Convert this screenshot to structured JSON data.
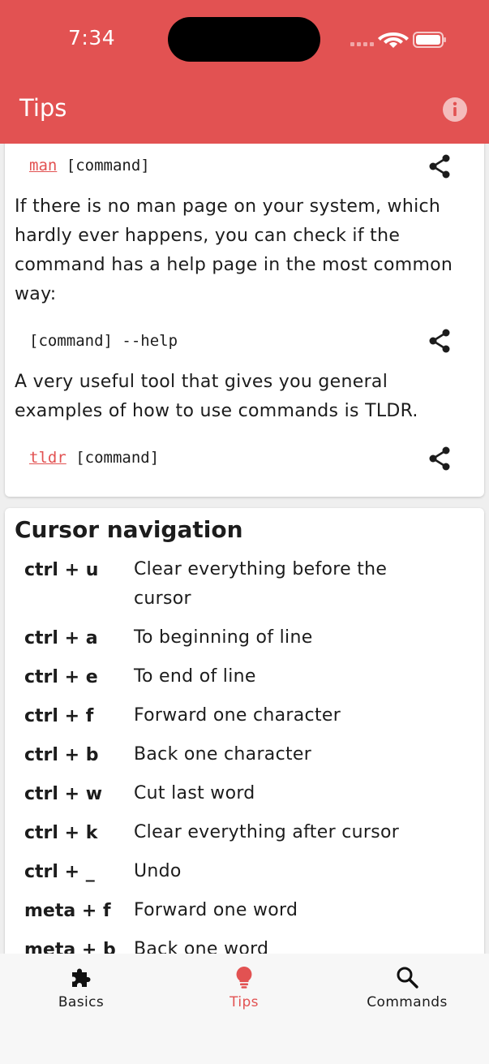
{
  "status_bar": {
    "time": "7:34"
  },
  "app_bar": {
    "title": "Tips",
    "info_icon": "info-icon",
    "color": "#e25252"
  },
  "card_help": {
    "cmd_man": {
      "link": "man",
      "arg": "[command]"
    },
    "para_help": "If there is no man page on your system, which hardly ever happens, you can check if the command has a help page in the most common way:",
    "cmd_help": {
      "text": "[command] --help"
    },
    "para_tldr": "A very useful tool that gives you general examples of how to use commands is TLDR.",
    "cmd_tldr": {
      "link": "tldr",
      "arg": "[command]"
    }
  },
  "cursor_nav": {
    "title": "Cursor navigation",
    "rows": [
      {
        "key": "ctrl + u",
        "desc": "Clear everything before the cursor"
      },
      {
        "key": "ctrl + a",
        "desc": "To beginning of line"
      },
      {
        "key": "ctrl + e",
        "desc": "To end of line"
      },
      {
        "key": "ctrl + f",
        "desc": "Forward one character"
      },
      {
        "key": "ctrl + b",
        "desc": "Back one character"
      },
      {
        "key": "ctrl + w",
        "desc": "Cut last word"
      },
      {
        "key": "ctrl + k",
        "desc": "Clear everything after cursor"
      },
      {
        "key": "ctrl + _",
        "desc": "Undo"
      },
      {
        "key": "meta + f",
        "desc": "Forward one word"
      },
      {
        "key": "meta + b",
        "desc": "Back one word"
      }
    ]
  },
  "bottom_nav": {
    "items": [
      {
        "label": "Basics",
        "icon": "puzzle-icon"
      },
      {
        "label": "Tips",
        "icon": "lightbulb-icon",
        "active": true
      },
      {
        "label": "Commands",
        "icon": "search-icon"
      }
    ]
  }
}
